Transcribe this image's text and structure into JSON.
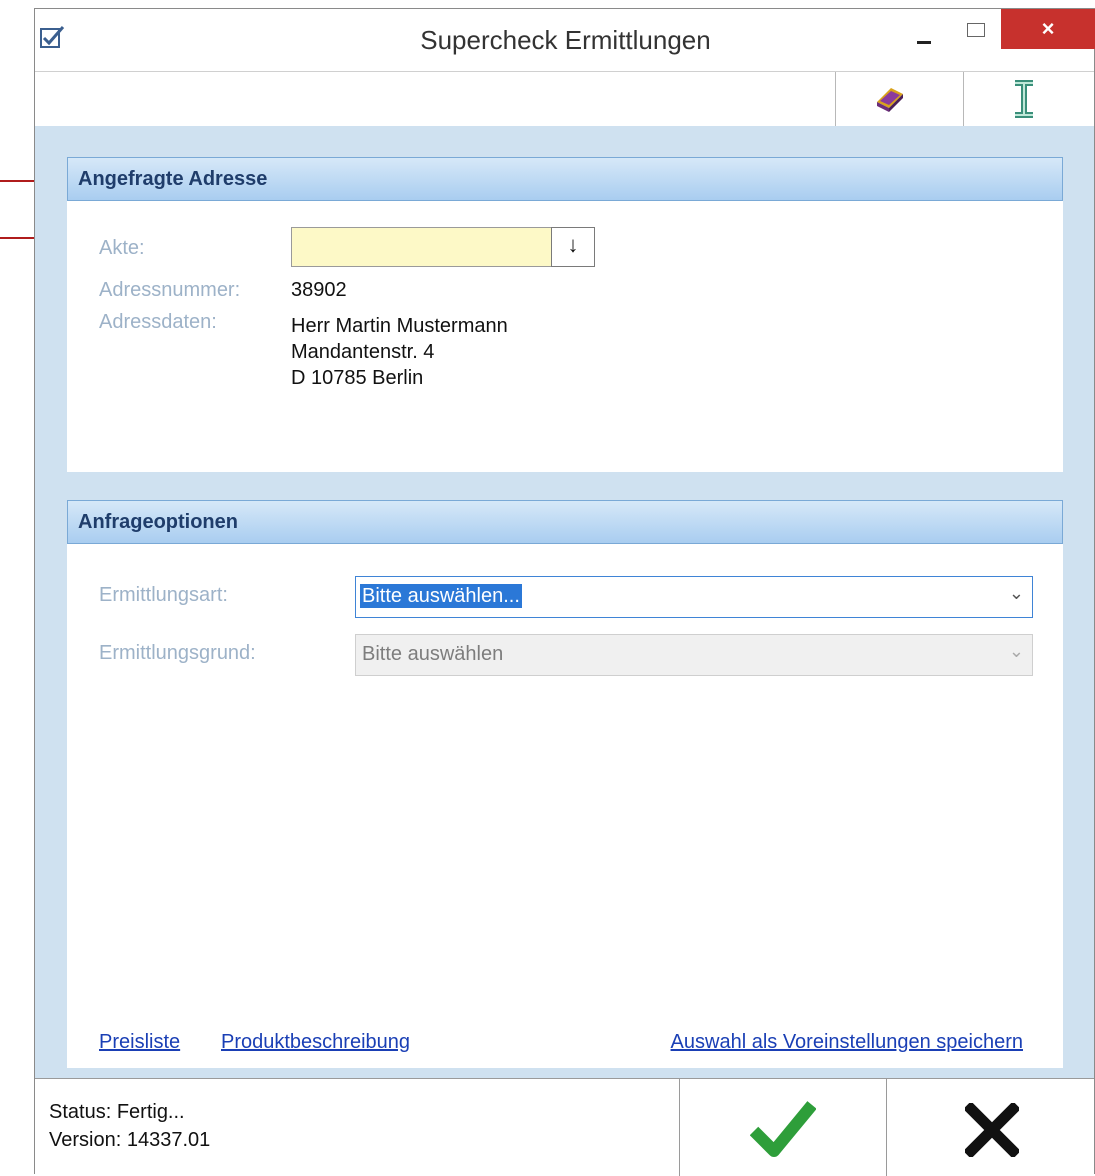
{
  "window": {
    "title": "Supercheck Ermittlungen",
    "close_glyph": "×",
    "icons": [
      "check-square-icon",
      "minimize-icon",
      "maximize-icon",
      "close-icon"
    ]
  },
  "toolbar": {
    "icons": [
      "book-icon",
      "text-cursor-icon"
    ]
  },
  "panel_address": {
    "title": "Angefragte Adresse",
    "akte_label": "Akte:",
    "akte_value": "",
    "akte_button_glyph": "↓",
    "adressnummer_label": "Adressnummer:",
    "adressnummer_value": "38902",
    "adressdaten_label": "Adressdaten:",
    "address_lines": [
      "Herr Martin Mustermann",
      "Mandantenstr. 4",
      "D 10785 Berlin"
    ]
  },
  "panel_options": {
    "title": "Anfrageoptionen",
    "ermittlungsart_label": "Ermittlungsart:",
    "ermittlungsart_value": "Bitte auswählen...",
    "ermittlungsgrund_label": "Ermittlungsgrund:",
    "ermittlungsgrund_value": "Bitte auswählen",
    "links": {
      "preisliste": "Preisliste",
      "produktbeschreibung": "Produktbeschreibung",
      "voreinstellungen": "Auswahl als Voreinstellungen speichern"
    }
  },
  "status": {
    "status_text": "Status: Fertig...",
    "version_text": "Version: 14337.01"
  },
  "colors": {
    "close_button": "#c7312d",
    "content_background": "#cfe1f0",
    "panel_header": "#a9cdf0",
    "akte_field": "#fdf9c7",
    "ok_check": "#2e9e3a",
    "cancel_x": "#111111",
    "annotation_arrow": "#b01c1c"
  }
}
